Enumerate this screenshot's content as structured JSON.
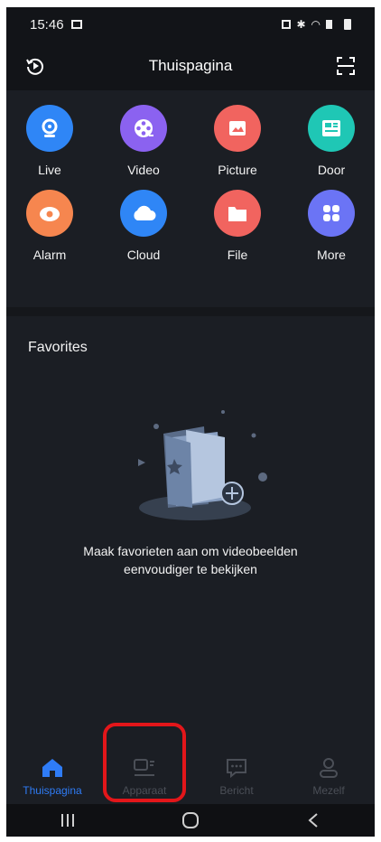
{
  "status_bar": {
    "time": "15:46"
  },
  "header": {
    "title": "Thuispagina",
    "left_icon": "playback-icon",
    "right_icon": "scan-icon"
  },
  "grid": [
    {
      "label": "Live",
      "icon": "camera-icon",
      "color": "#2f86f6"
    },
    {
      "label": "Video",
      "icon": "film-reel-icon",
      "color": "#8b62f0"
    },
    {
      "label": "Picture",
      "icon": "image-icon",
      "color": "#f1645f"
    },
    {
      "label": "Door",
      "icon": "intercom-icon",
      "color": "#1fc7b5"
    },
    {
      "label": "Alarm",
      "icon": "alarm-icon",
      "color": "#f6864f"
    },
    {
      "label": "Cloud",
      "icon": "cloud-icon",
      "color": "#2f86f6"
    },
    {
      "label": "File",
      "icon": "folder-icon",
      "color": "#f1645f"
    },
    {
      "label": "More",
      "icon": "apps-icon",
      "color": "#6b74f5"
    }
  ],
  "favorites": {
    "title": "Favorites",
    "empty_line1": "Maak favorieten aan om videobeelden",
    "empty_line2": "eenvoudiger te bekijken"
  },
  "tabs": [
    {
      "label": "Thuispagina",
      "icon": "home-icon",
      "active": true
    },
    {
      "label": "Apparaat",
      "icon": "device-icon",
      "active": false
    },
    {
      "label": "Bericht",
      "icon": "message-icon",
      "active": false
    },
    {
      "label": "Mezelf",
      "icon": "profile-icon",
      "active": false
    }
  ],
  "colors": {
    "accent": "#2f7cf6",
    "highlight": "#e3161a",
    "background": "#1b1e24"
  }
}
